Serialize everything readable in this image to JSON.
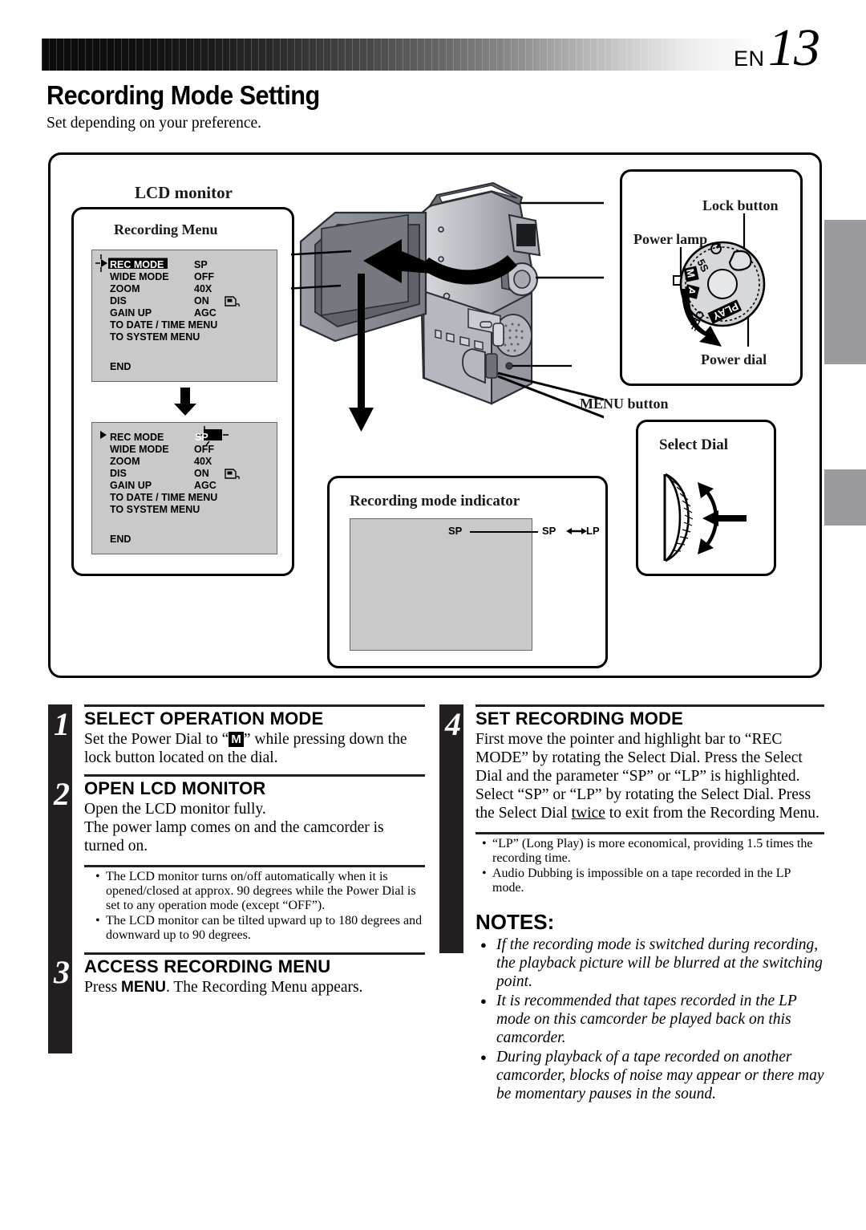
{
  "header": {
    "lang_code": "EN",
    "page_number": "13",
    "title": "Recording Mode Setting",
    "subtitle": "Set depending on your preference."
  },
  "diagram": {
    "lcd_monitor_label": "LCD monitor",
    "recording_menu_label": "Recording Menu",
    "menu_screen_1": {
      "rows": [
        {
          "label": "REC MODE",
          "value": "SP",
          "pointer": "▶",
          "selected": true
        },
        {
          "label": "WIDE MODE",
          "value": "OFF"
        },
        {
          "label": "ZOOM",
          "value": "40X"
        },
        {
          "label": "DIS",
          "value": "ON"
        },
        {
          "label": "GAIN UP",
          "value": "AGC"
        },
        {
          "label": "TO DATE / TIME MENU",
          "value": ""
        },
        {
          "label": "TO SYSTEM MENU",
          "value": ""
        }
      ],
      "end_label": "END"
    },
    "menu_screen_2": {
      "rows": [
        {
          "label": "REC MODE",
          "value": "SP",
          "pointer": "▶",
          "value_highlighted": true
        },
        {
          "label": "WIDE MODE",
          "value": "OFF"
        },
        {
          "label": "ZOOM",
          "value": "40X"
        },
        {
          "label": "DIS",
          "value": "ON"
        },
        {
          "label": "GAIN UP",
          "value": "AGC"
        },
        {
          "label": "TO DATE / TIME MENU",
          "value": ""
        },
        {
          "label": "TO SYSTEM MENU",
          "value": ""
        }
      ],
      "end_label": "END"
    },
    "rec_indicator": {
      "title": "Recording mode indicator",
      "screen_value": "SP",
      "callout_left": "SP",
      "callout_right": "LP"
    },
    "power_dial": {
      "lock_button_label": "Lock button",
      "power_lamp_label": "Power lamp",
      "power_dial_label": "Power dial",
      "positions": [
        "5S",
        "M",
        "A",
        "OFF",
        "PLAY"
      ]
    },
    "select_dial_label": "Select Dial",
    "menu_button_label": "MENU button"
  },
  "steps_left": [
    {
      "number": "1",
      "title": "SELECT OPERATION MODE",
      "text_before": "Set the Power Dial to “",
      "icon": "M",
      "text_after": "” while pressing down the lock button located on the dial."
    },
    {
      "number": "2",
      "title": "OPEN LCD MONITOR",
      "text": "Open the LCD monitor fully.\nThe power lamp comes on and the camcorder is turned on."
    },
    {
      "number": "3",
      "title": "ACCESS RECORDING MENU",
      "text_before": "Press ",
      "bold": "MENU",
      "text_after": ". The Recording Menu appears."
    }
  ],
  "left_bullets": [
    "The LCD monitor turns on/off automatically when it is opened/closed at approx. 90 degrees while the Power Dial is set to any operation mode (except “OFF”).",
    "The LCD monitor can be tilted upward up to 180 degrees and downward up to 90 degrees."
  ],
  "step_right": {
    "number": "4",
    "title": "SET RECORDING MODE",
    "text_part1": "First move the pointer and highlight bar to “REC MODE” by rotating the Select Dial. Press the Select Dial and the parameter “SP” or “LP” is highlighted. Select “SP” or “LP” by rotating the Select Dial. Press the Select Dial ",
    "emphasis": "twice",
    "text_part2": " to exit from the Recording Menu."
  },
  "right_bullets": [
    "“LP” (Long Play) is more economical, providing 1.5 times the recording time.",
    "Audio Dubbing is impossible on a tape recorded in the LP mode."
  ],
  "notes": {
    "title": "NOTES:",
    "items": [
      "If the recording mode is switched during recording, the playback picture will be blurred at the switching point.",
      "It is recommended that tapes recorded in the LP mode on this camcorder be played back on this camcorder.",
      "During playback of a tape recorded on another camcorder, blocks of noise may appear or there may be momentary pauses in the sound."
    ]
  },
  "colors": {
    "ink": "#231f20",
    "screen_gray": "#c9c9c9",
    "tab_gray": "#9a9a9f"
  }
}
